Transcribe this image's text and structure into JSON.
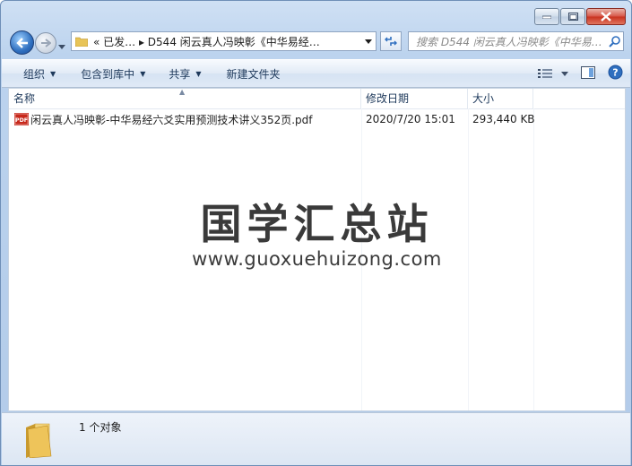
{
  "window": {
    "address_segments": "«  已发…  ▸  D544 闲云真人冯映彰《中华易经…",
    "search_placeholder": "搜索 D544 闲云真人冯映彰《中华易…"
  },
  "toolbar": {
    "organize": "组织",
    "include_in_library": "包含到库中",
    "share": "共享",
    "new_folder": "新建文件夹"
  },
  "columns": {
    "name": "名称",
    "date_modified": "修改日期",
    "size": "大小"
  },
  "files": [
    {
      "name": "闲云真人冯映彰-中华易经六爻实用预测技术讲义352页.pdf",
      "date_modified": "2020/7/20 15:01",
      "size": "293,440 KB",
      "icon": "pdf-icon"
    }
  ],
  "watermark": {
    "title": "国学汇总站",
    "url": "www.guoxuehuizong.com"
  },
  "status": {
    "item_count": "1 个对象"
  },
  "colors": {
    "accent": "#2f6fbf",
    "close_button": "#c8321f"
  }
}
